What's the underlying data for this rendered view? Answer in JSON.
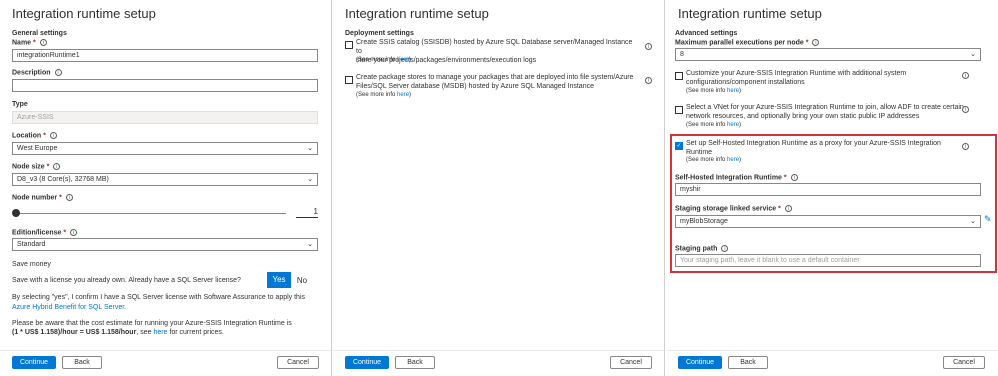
{
  "panel1": {
    "title": "Integration runtime setup",
    "general_settings": "General settings",
    "name_label": "Name",
    "name_value": "integrationRuntime1",
    "description_label": "Description",
    "description_value": "",
    "type_label": "Type",
    "type_value": "Azure-SSIS",
    "location_label": "Location",
    "location_value": "West Europe",
    "node_size_label": "Node size",
    "node_size_value": "D8_v3 (8 Core(s), 32768 MB)",
    "node_number_label": "Node number",
    "node_number_value": "1",
    "edition_label": "Edition/license",
    "edition_value": "Standard",
    "save_money": "Save money",
    "license_question": "Save with a license you already own. Already have a SQL Server license?",
    "yes_label": "Yes",
    "no_label": "No",
    "confirm_text_1": "By selecting \"yes\", I confirm I have a SQL Server license with Software Assurance to apply this",
    "confirm_link": "Azure Hybrid Benefit for SQL Server.",
    "cost_text_1": "Please be aware that the cost estimate for running your Azure-SSIS Integration Runtime is",
    "cost_bold": "(1 * US$ 1.158)/hour = US$ 1.158/hour",
    "cost_mid": ", see ",
    "cost_link": "here",
    "cost_end": " for current prices.",
    "continue": "Continue",
    "back": "Back",
    "cancel": "Cancel"
  },
  "panel2": {
    "title": "Integration runtime setup",
    "deployment_settings": "Deployment settings",
    "opt1_line1": "Create SSIS catalog (SSISDB) hosted by Azure SQL Database server/Managed Instance to",
    "opt1_line2": "store your projects/packages/environments/execution logs",
    "opt2_line1": "Create package stores to manage your packages that are deployed into file system/Azure",
    "opt2_line2": "Files/SQL Server database (MSDB) hosted by Azure SQL Managed Instance",
    "see_more": "(See more info ",
    "here": "here",
    "close_paren": ")",
    "continue": "Continue",
    "back": "Back",
    "cancel": "Cancel"
  },
  "panel3": {
    "title": "Integration runtime setup",
    "advanced_settings": "Advanced settings",
    "max_parallel_label": "Maximum parallel executions per node",
    "max_parallel_value": "8",
    "opt1_line1": "Customize your Azure-SSIS Integration Runtime with additional system",
    "opt1_line2": "configurations/component installations",
    "opt2_line1": "Select a VNet for your Azure-SSIS Integration Runtime to join, allow ADF to create certain",
    "opt2_line2": "network resources, and optionally bring your own static public IP addresses",
    "opt3_line1": "Set up Self-Hosted Integration Runtime as a proxy for your Azure-SSIS Integration",
    "opt3_line2": "Runtime",
    "see_more": "(See more info ",
    "here": "here",
    "close_paren": ")",
    "shir_label": "Self-Hosted Integration Runtime",
    "shir_value": "myshir",
    "staging_service_label": "Staging storage linked service",
    "staging_service_value": "myBlobStorage",
    "staging_path_label": "Staging path",
    "staging_path_placeholder": "Your staging path, leave it blank to use a default container",
    "continue": "Continue",
    "back": "Back",
    "cancel": "Cancel"
  },
  "colors": {
    "accent": "#0078d4",
    "highlight_box": "#d13438",
    "required": "#a4262c"
  },
  "icons": [
    "info-icon",
    "chevron-down-icon",
    "checkmark-icon",
    "pencil-icon"
  ]
}
